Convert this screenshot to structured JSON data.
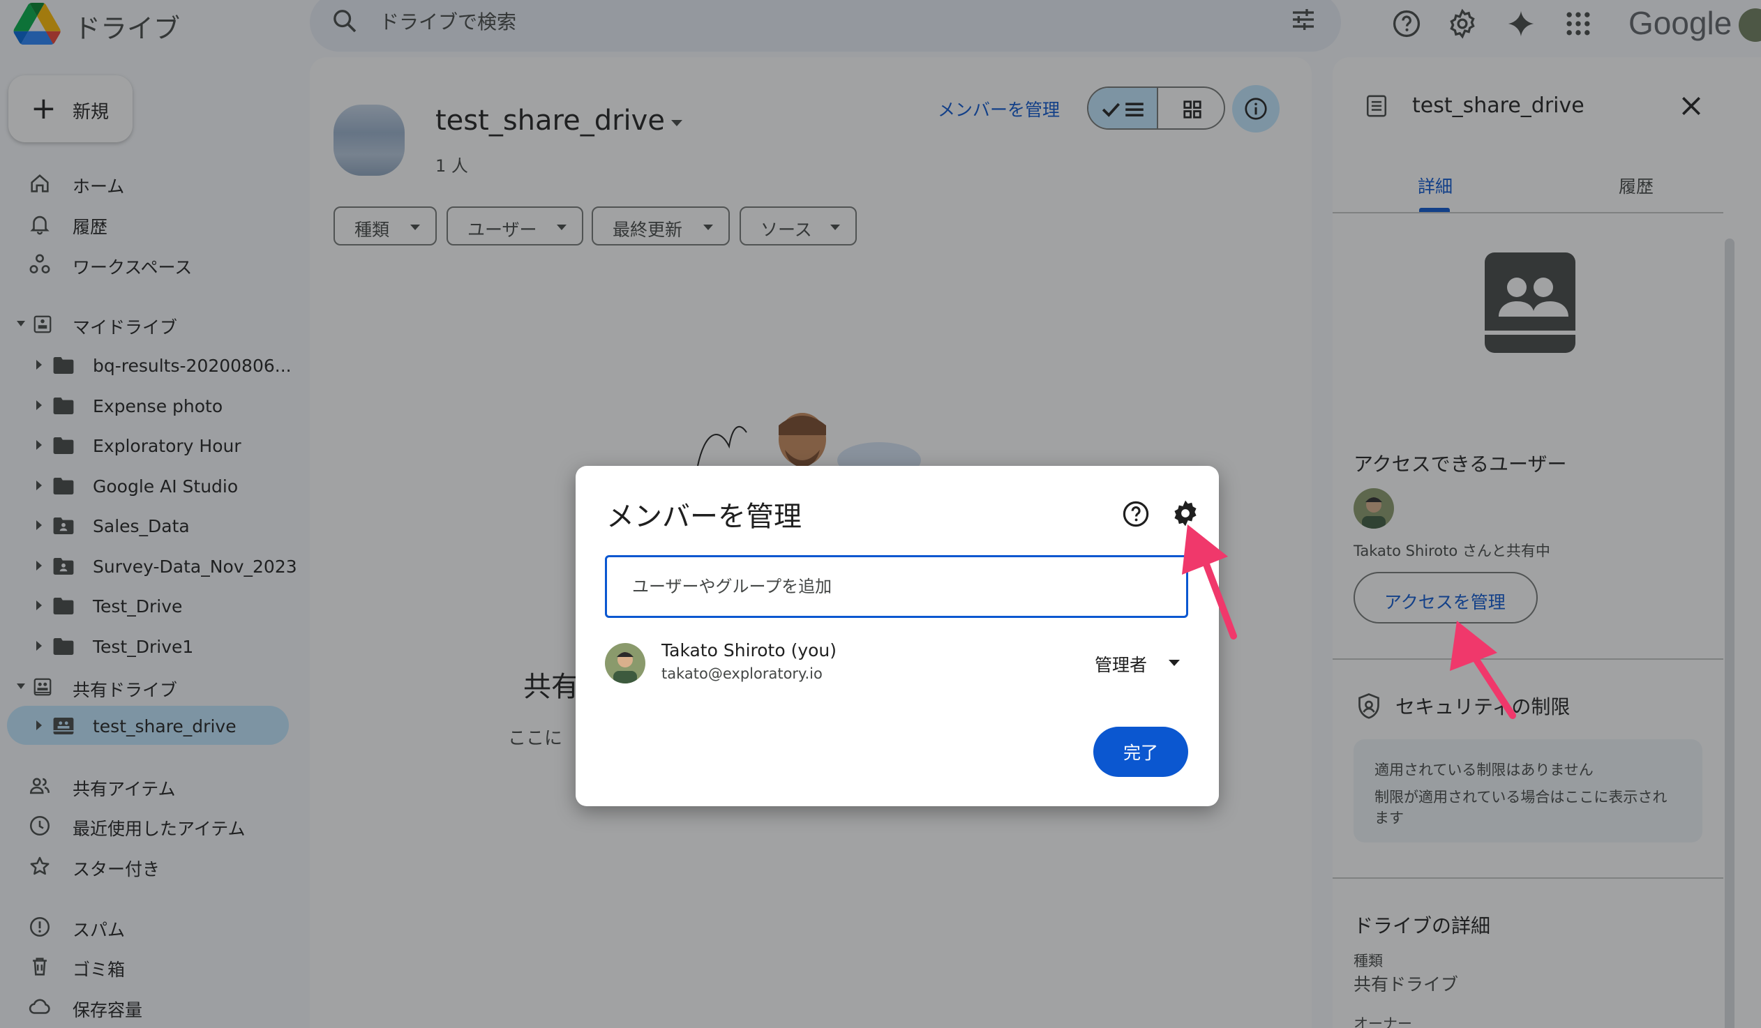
{
  "topbar": {
    "app_name": "ドライブ",
    "search_placeholder": "ドライブで検索",
    "brand_word": "Google"
  },
  "sidebar": {
    "new_label": "新規",
    "nav_top": [
      {
        "label": "ホーム",
        "icon": "home-icon"
      },
      {
        "label": "履歴",
        "icon": "bell-icon"
      },
      {
        "label": "ワークスペース",
        "icon": "workspaces-icon"
      }
    ],
    "my_drive": {
      "label": "マイドライブ",
      "folders": [
        {
          "label": "bq-results-20200806..."
        },
        {
          "label": "Expense photo"
        },
        {
          "label": "Exploratory Hour"
        },
        {
          "label": "Google AI Studio"
        },
        {
          "label": "Sales_Data"
        },
        {
          "label": "Survey-Data_Nov_2023"
        },
        {
          "label": "Test_Drive"
        },
        {
          "label": "Test_Drive1"
        }
      ]
    },
    "shared_drives": {
      "label": "共有ドライブ",
      "items": [
        {
          "label": "test_share_drive"
        }
      ]
    },
    "nav_bottom": [
      {
        "label": "共有アイテム",
        "icon": "people-icon"
      },
      {
        "label": "最近使用したアイテム",
        "icon": "clock-icon"
      },
      {
        "label": "スター付き",
        "icon": "star-icon"
      },
      {
        "label": "スパム",
        "icon": "spam-icon"
      },
      {
        "label": "ゴミ箱",
        "icon": "trash-icon"
      },
      {
        "label": "保存容量",
        "icon": "cloud-icon"
      }
    ]
  },
  "main": {
    "drive_title": "test_share_drive",
    "member_count": "1 人",
    "manage_members_link": "メンバーを管理",
    "filters": [
      "種類",
      "ユーザー",
      "最終更新",
      "ソース"
    ],
    "empty_title": "共有",
    "empty_sub": "ここに"
  },
  "details_panel": {
    "title": "test_share_drive",
    "tabs": [
      "詳細",
      "履歴"
    ],
    "active_tab": "詳細",
    "access_heading": "アクセスできるユーザー",
    "shared_with_text": "Takato Shiroto さんと共有中",
    "manage_access_label": "アクセスを管理",
    "security_heading": "セキュリティの制限",
    "no_restrictions": "適用されている制限はありません",
    "restrictions_note": "制限が適用されている場合はここに表示されます",
    "drive_details_heading": "ドライブの詳細",
    "type_label": "種類",
    "type_value": "共有ドライブ",
    "owner_label": "オーナー"
  },
  "dialog": {
    "title": "メンバーを管理",
    "input_placeholder": "ユーザーやグループを追加",
    "member": {
      "name": "Takato Shiroto (you)",
      "email": "takato@exploratory.io",
      "role": "管理者"
    },
    "done_label": "完了"
  },
  "colors": {
    "accent": "#0b57d0",
    "selected_bg": "#c2e7ff",
    "annotation_arrow": "#f0386b"
  }
}
